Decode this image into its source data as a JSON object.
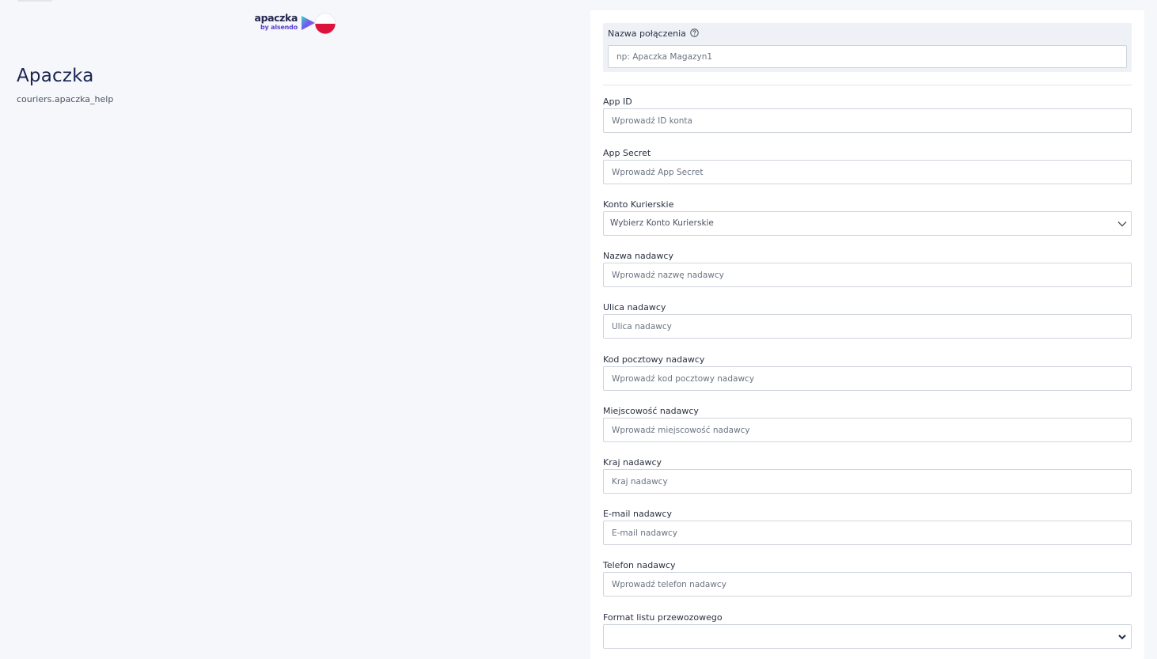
{
  "logo": {
    "word": "apaczka",
    "sub": "by alsendo"
  },
  "page": {
    "title": "Apaczka",
    "subtitle": "couriers.apaczka_help"
  },
  "connection": {
    "label": "Nazwa połączenia",
    "placeholder": "np: Apaczka Magazyn1"
  },
  "fields": [
    {
      "label": "App ID",
      "placeholder": "Wprowadź ID konta"
    },
    {
      "label": "App Secret",
      "placeholder": "Wprowadź App Secret"
    },
    {
      "label": "Konto Kurierskie",
      "selected": "Wybierz Konto Kurierskie"
    },
    {
      "label": "Nazwa nadawcy",
      "placeholder": "Wprowadź nazwę nadawcy"
    },
    {
      "label": "Ulica nadawcy",
      "placeholder": "Ulica nadawcy"
    },
    {
      "label": "Kod pocztowy nadawcy",
      "placeholder": "Wprowadź kod pocztowy nadawcy"
    },
    {
      "label": "Miejscowość nadawcy",
      "placeholder": "Wprowadź miejscowość nadawcy"
    },
    {
      "label": "Kraj nadawcy",
      "placeholder": "Kraj nadawcy"
    },
    {
      "label": "E-mail nadawcy",
      "placeholder": "E-mail nadawcy"
    },
    {
      "label": "Telefon nadawcy",
      "placeholder": "Wprowadź telefon nadawcy"
    },
    {
      "label": "Format listu przewozowego",
      "selected": ""
    }
  ],
  "icons": {
    "help": "question-circle-icon",
    "dropdown": "chevron-down-icon",
    "flag": "poland-flag-icon"
  },
  "colors": {
    "background": "#f5f7fb",
    "panel": "#ffffff",
    "title": "#1a2550",
    "brand_purple": "#5b3fd6",
    "flag_red": "#dc143c"
  }
}
